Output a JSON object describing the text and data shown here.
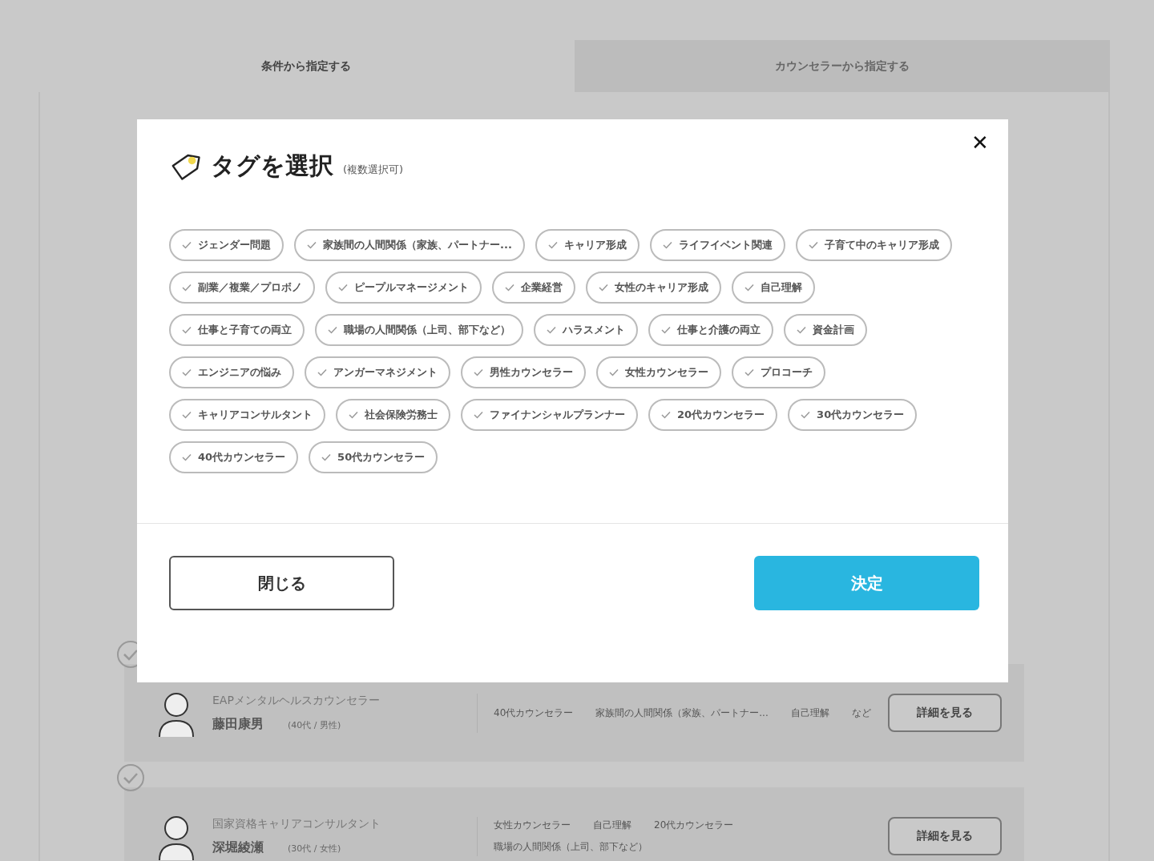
{
  "tabs": [
    {
      "label": "条件から指定する",
      "selected": true
    },
    {
      "label": "カウンセラーから指定する",
      "selected": false
    }
  ],
  "counselors": [
    {
      "title": "EAPメンタルヘルスカウンセラー",
      "name": "藤田康男",
      "meta": "(40代 / 男性)",
      "tags": [
        "40代カウンセラー",
        "家族間の人間関係（家族、パートナー...",
        "自己理解",
        "など"
      ],
      "button": "詳細を見る"
    },
    {
      "title": "国家資格キャリアコンサルタント",
      "name": "深堀綾瀬",
      "meta": "(30代 / 女性)",
      "tags": [
        "女性カウンセラー",
        "自己理解",
        "20代カウンセラー",
        "職場の人間関係（上司、部下など）"
      ],
      "button": "詳細を見る"
    }
  ],
  "modal": {
    "title": "タグを選択",
    "note": "(複数選択可)",
    "close": "✕",
    "tags": [
      {
        "label": "ジェンダー問題",
        "selected": false
      },
      {
        "label": "家族間の人間関係（家族、パートナー...",
        "selected": false
      },
      {
        "label": "キャリア形成",
        "selected": false
      },
      {
        "label": "ライフイベント関連",
        "selected": false
      },
      {
        "label": "子育て中のキャリア形成",
        "selected": false
      },
      {
        "label": "副業／複業／プロボノ",
        "selected": false
      },
      {
        "label": "ピープルマネージメント",
        "selected": false
      },
      {
        "label": "企業経営",
        "selected": false
      },
      {
        "label": "女性のキャリア形成",
        "selected": false
      },
      {
        "label": "自己理解",
        "selected": false
      },
      {
        "label": "仕事と子育ての両立",
        "selected": false
      },
      {
        "label": "職場の人間関係（上司、部下など）",
        "selected": false
      },
      {
        "label": "ハラスメント",
        "selected": false
      },
      {
        "label": "仕事と介護の両立",
        "selected": false
      },
      {
        "label": "資金計画",
        "selected": false
      },
      {
        "label": "エンジニアの悩み",
        "selected": false
      },
      {
        "label": "アンガーマネジメント",
        "selected": false
      },
      {
        "label": "男性カウンセラー",
        "selected": false
      },
      {
        "label": "女性カウンセラー",
        "selected": false
      },
      {
        "label": "プロコーチ",
        "selected": false
      },
      {
        "label": "キャリアコンサルタント",
        "selected": false
      },
      {
        "label": "社会保険労務士",
        "selected": false
      },
      {
        "label": "ファイナンシャルプランナー",
        "selected": false
      },
      {
        "label": "20代カウンセラー",
        "selected": false
      },
      {
        "label": "30代カウンセラー",
        "selected": false
      },
      {
        "label": "40代カウンセラー",
        "selected": false
      },
      {
        "label": "50代カウンセラー",
        "selected": false
      }
    ],
    "cancel": "閉じる",
    "confirm": "決定"
  }
}
